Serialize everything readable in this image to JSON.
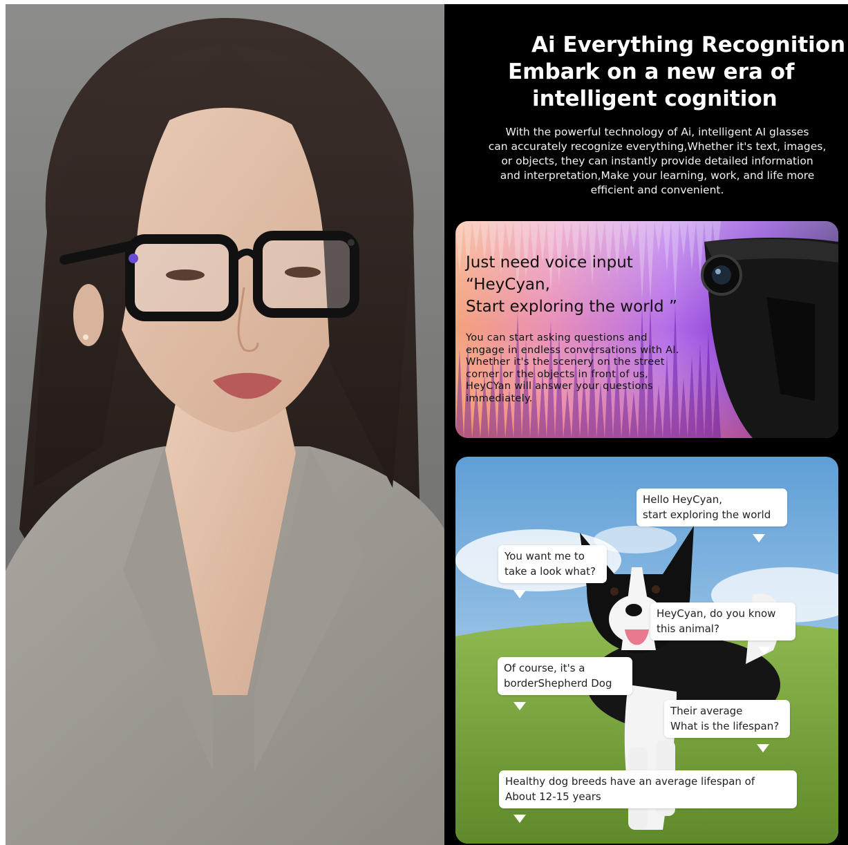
{
  "headline": {
    "line1": "Ai Everything Recognition",
    "line2": "Embark on a new era of",
    "line3": "intelligent cognition"
  },
  "description": {
    "line1": "With the powerful technology of  Ai,          intelligent AI glasses",
    "line2": "can accurately recognize everything,Whether it's text, images,",
    "line3": "or objects, they can instantly provide detailed information",
    "line4": "and interpretation,Make your learning, work, and life more",
    "line5": "efficient and convenient."
  },
  "voice_card": {
    "title_line1": "Just need voice input",
    "title_line2": "“HeyCyan,",
    "title_line3": "Start exploring the world ”",
    "body_line1": "You can start asking questions and",
    "body_line2": "engage in endless conversations with AI.",
    "body_line3": "Whether it's the scenery on the street",
    "body_line4": "corner or the objects in front of us,",
    "body_line5": "HeyCYan will answer your questions",
    "body_line6": "immediately."
  },
  "chat": {
    "bubble1": {
      "line1": "Hello HeyCyan,",
      "line2": "start exploring the world"
    },
    "bubble2": {
      "line1": "You want me to",
      "line2": "take a look what?"
    },
    "bubble3": {
      "line1": "HeyCyan, do you know",
      "line2": "this animal?"
    },
    "bubble4": {
      "line1": "Of course, it's a",
      "line2": "borderShepherd Dog"
    },
    "bubble5": {
      "line1": "Their average",
      "line2": "What is the lifespan?"
    },
    "bubble6": {
      "line1": "Healthy dog breeds have an average lifespan of",
      "line2": "About 12-15 years"
    }
  },
  "colors": {
    "panel_background": "#000000",
    "headline_text": "#ffffff",
    "bubble_background": "#ffffff",
    "sky_top": "#5f9fd6",
    "grass": "#7aa33d"
  }
}
